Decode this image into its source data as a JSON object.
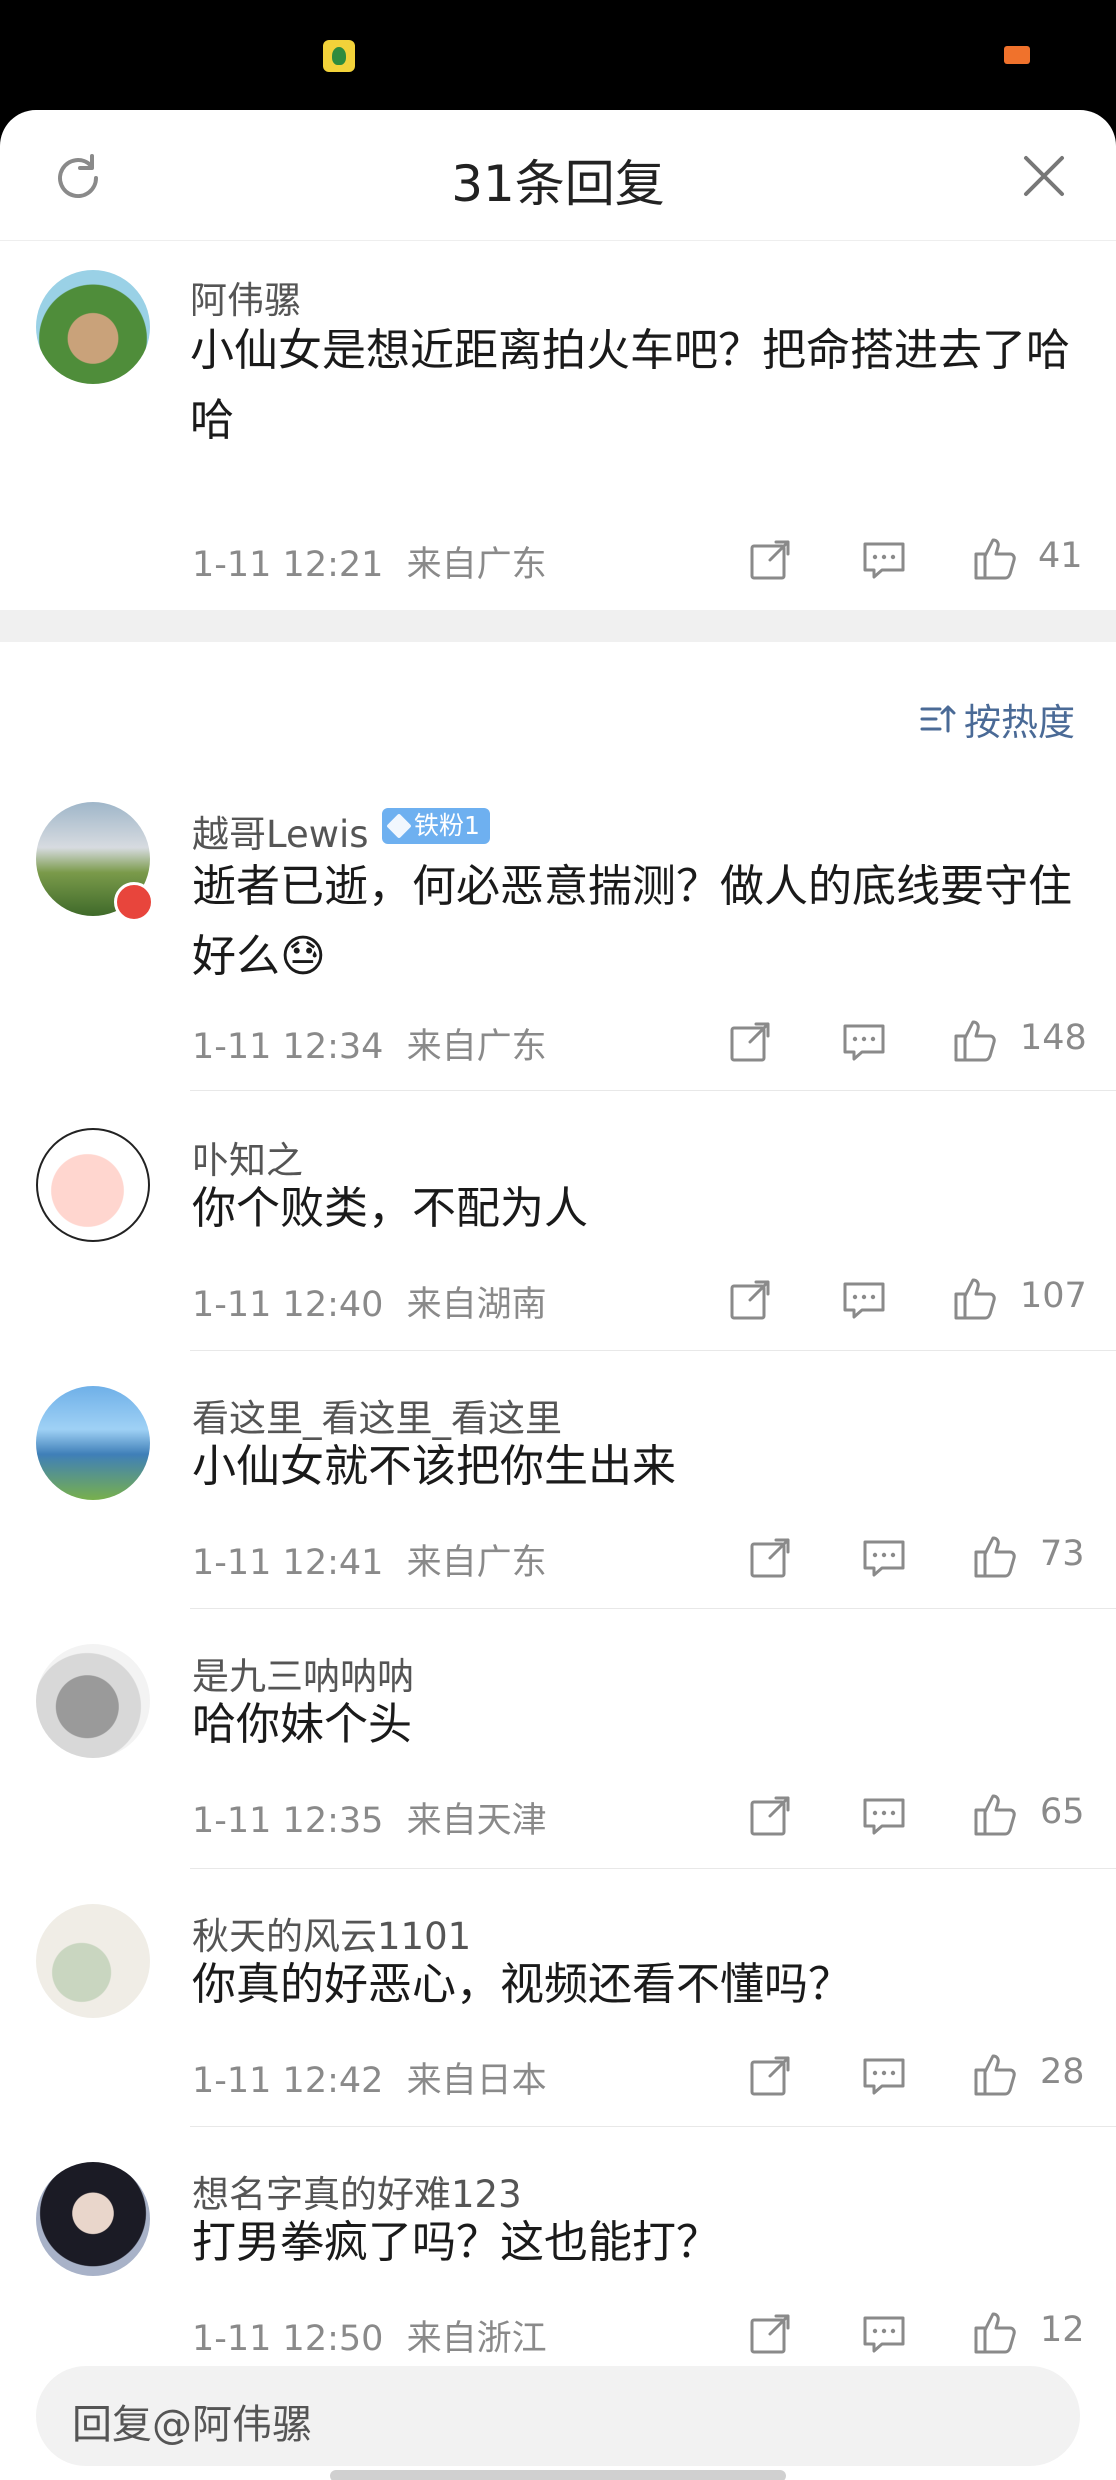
{
  "header": {
    "title": "31条回复"
  },
  "root_comment": {
    "username": "阿伟骡",
    "content": "小仙女是想近距离拍火车吧？把命搭进去了哈哈",
    "time": "1-11 12:21",
    "location": "来自广东",
    "likes": "41"
  },
  "sort": {
    "label": "按热度"
  },
  "replies": [
    {
      "username": "越哥Lewis",
      "badge": "铁粉1",
      "content": "逝者已逝，何必恶意揣测？做人的底线要守住好么😓",
      "time": "1-11 12:34",
      "location": "来自广东",
      "likes": "148"
    },
    {
      "username": "卟知之",
      "content": "你个败类，不配为人",
      "time": "1-11 12:40",
      "location": "来自湖南",
      "likes": "107"
    },
    {
      "username": "看这里_看这里_看这里",
      "content": "小仙女就不该把你生出来",
      "time": "1-11 12:41",
      "location": "来自广东",
      "likes": "73"
    },
    {
      "username": "是九三呐呐呐",
      "content": "哈你妹个头",
      "time": "1-11 12:35",
      "location": "来自天津",
      "likes": "65"
    },
    {
      "username": "秋天的风云1101",
      "content": "你真的好恶心，视频还看不懂吗？",
      "time": "1-11 12:42",
      "location": "来自日本",
      "likes": "28"
    },
    {
      "username": "想名字真的好难123",
      "content": "打男拳疯了吗？这也能打？",
      "time": "1-11 12:50",
      "location": "来自浙江",
      "likes": "12"
    }
  ],
  "reply_box": {
    "placeholder": "回复@阿伟骡"
  }
}
